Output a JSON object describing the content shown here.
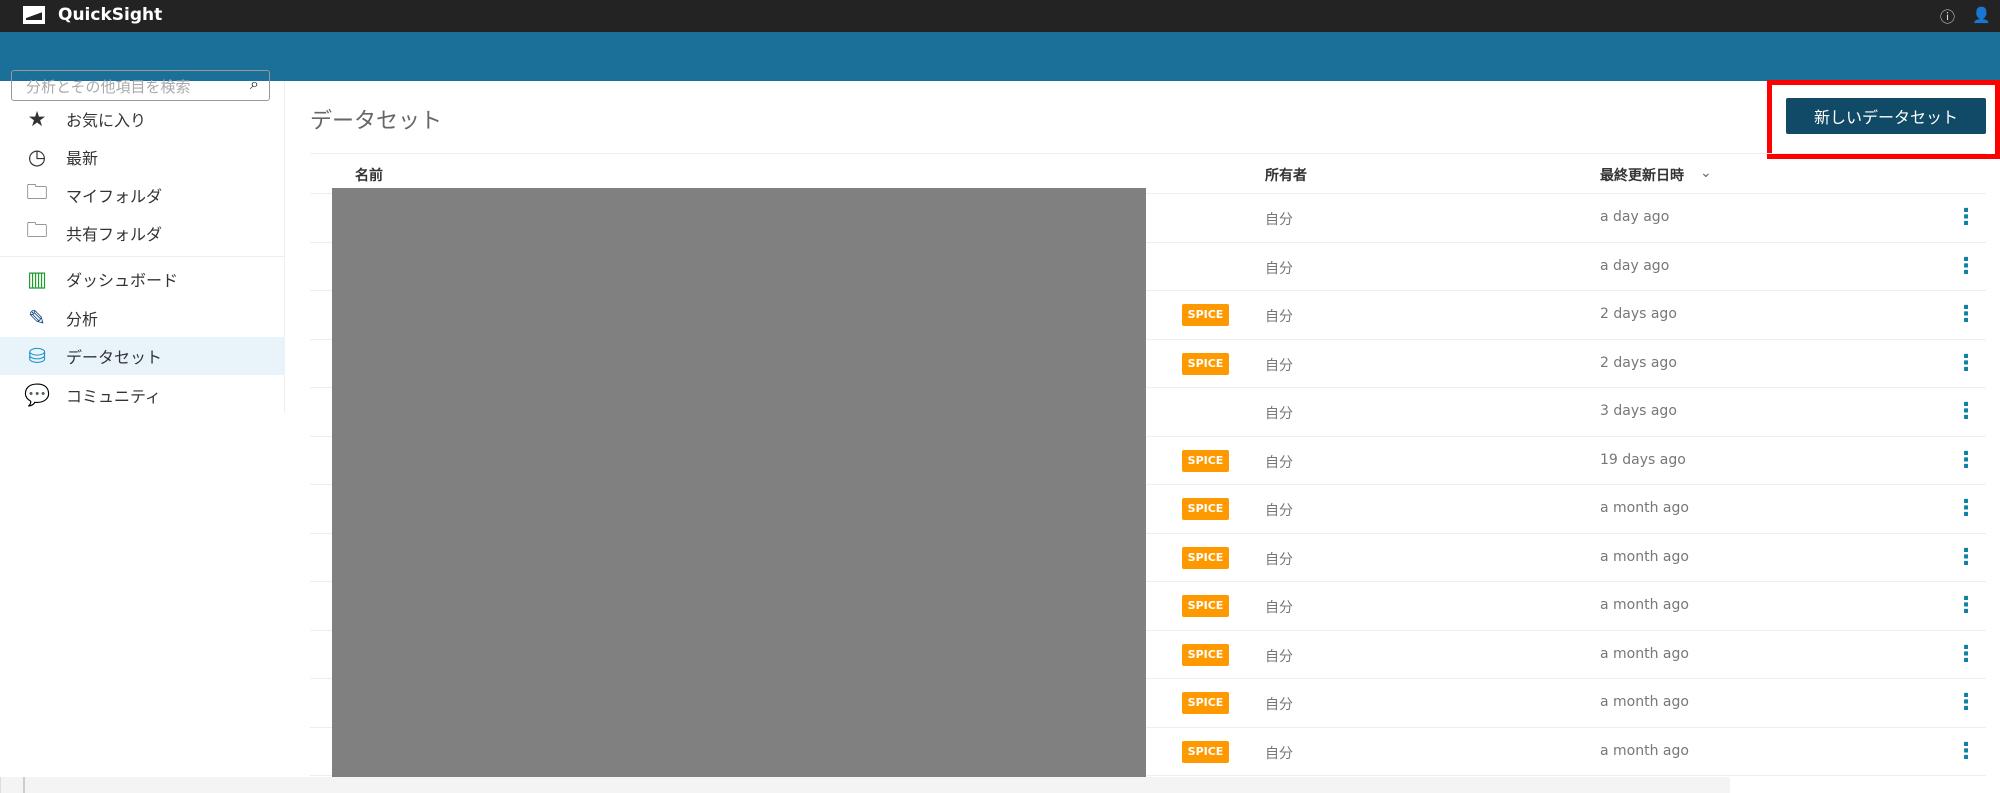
{
  "app": {
    "title": "QuickSight"
  },
  "search": {
    "placeholder": "分析とその他項目を検索"
  },
  "sidebar": {
    "items": [
      {
        "label": "お気に入り",
        "icon": "star-icon",
        "glyph": "★"
      },
      {
        "label": "最新",
        "icon": "clock-icon",
        "glyph": "◷"
      },
      {
        "label": "マイフォルダ",
        "icon": "folder-icon",
        "glyph": "🗀"
      },
      {
        "label": "共有フォルダ",
        "icon": "shared-folder-icon",
        "glyph": "🗀"
      },
      {
        "label": "ダッシュボード",
        "icon": "dashboard-icon",
        "glyph": "▥"
      },
      {
        "label": "分析",
        "icon": "analysis-icon",
        "glyph": "✎"
      },
      {
        "label": "データセット",
        "icon": "dataset-icon",
        "glyph": "⛁",
        "active": true
      },
      {
        "label": "コミュニティ",
        "icon": "community-icon",
        "glyph": "💬"
      }
    ]
  },
  "main": {
    "title": "データセット",
    "new_button": "新しいデータセット",
    "columns": {
      "name": "名前",
      "owner": "所有者",
      "updated": "最終更新日時",
      "sort_icon": "⌄"
    },
    "rows": [
      {
        "spice": false,
        "owner": "自分",
        "updated": "a day ago"
      },
      {
        "spice": false,
        "owner": "自分",
        "updated": "a day ago"
      },
      {
        "spice": true,
        "owner": "自分",
        "updated": "2 days ago"
      },
      {
        "spice": true,
        "owner": "自分",
        "updated": "2 days ago"
      },
      {
        "spice": false,
        "owner": "自分",
        "updated": "3 days ago"
      },
      {
        "spice": true,
        "owner": "自分",
        "updated": "19 days ago"
      },
      {
        "spice": true,
        "owner": "自分",
        "updated": "a month ago"
      },
      {
        "spice": true,
        "owner": "自分",
        "updated": "a month ago"
      },
      {
        "spice": true,
        "owner": "自分",
        "updated": "a month ago"
      },
      {
        "spice": true,
        "owner": "自分",
        "updated": "a month ago"
      },
      {
        "spice": true,
        "owner": "自分",
        "updated": "a month ago"
      },
      {
        "spice": true,
        "owner": "自分",
        "updated": "a month ago"
      }
    ],
    "spice_label": "SPICE"
  },
  "colors": {
    "topbar": "#232323",
    "bluebar": "#1a7098",
    "button": "#114a66",
    "spice": "#ff9900",
    "highlight": "#ff0000"
  }
}
